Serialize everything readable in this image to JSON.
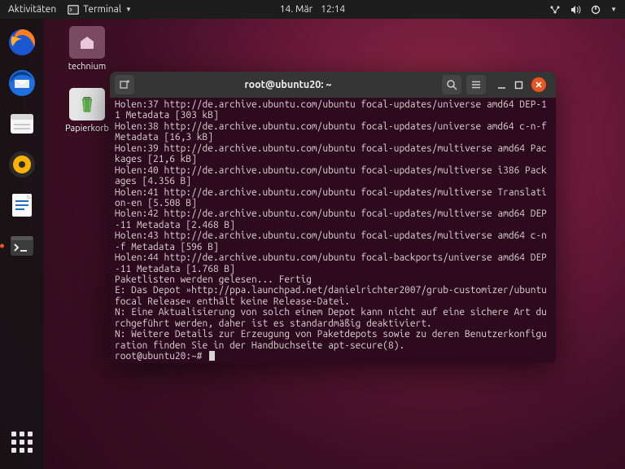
{
  "topbar": {
    "activities_label": "Aktivitäten",
    "app_name": "Terminal",
    "date": "14. Mär",
    "time": "12:14"
  },
  "desktop": {
    "home_label": "technium",
    "trash_label": "Papierkorb"
  },
  "dock": {
    "items": [
      {
        "name": "firefox"
      },
      {
        "name": "thunderbird"
      },
      {
        "name": "files"
      },
      {
        "name": "rhythmbox"
      },
      {
        "name": "libreoffice-writer"
      },
      {
        "name": "terminal",
        "active": true
      }
    ]
  },
  "terminal": {
    "title": "root@ubuntu20: ~",
    "lines": [
      "Holen:37 http://de.archive.ubuntu.com/ubuntu focal-updates/universe amd64 DEP-11 Metadata [303 kB]",
      "Holen:38 http://de.archive.ubuntu.com/ubuntu focal-updates/universe amd64 c-n-f Metadata [16,3 kB]",
      "Holen:39 http://de.archive.ubuntu.com/ubuntu focal-updates/multiverse amd64 Packages [21,6 kB]",
      "Holen:40 http://de.archive.ubuntu.com/ubuntu focal-updates/multiverse i386 Packages [4.356 B]",
      "Holen:41 http://de.archive.ubuntu.com/ubuntu focal-updates/multiverse Translation-en [5.508 B]",
      "Holen:42 http://de.archive.ubuntu.com/ubuntu focal-updates/multiverse amd64 DEP-11 Metadata [2.468 B]",
      "Holen:43 http://de.archive.ubuntu.com/ubuntu focal-updates/multiverse amd64 c-n-f Metadata [596 B]",
      "Holen:44 http://de.archive.ubuntu.com/ubuntu focal-backports/universe amd64 DEP-11 Metadata [1.768 B]",
      "Paketlisten werden gelesen... Fertig",
      "E: Das Depot »http://ppa.launchpad.net/danielrichter2007/grub-customizer/ubuntu focal Release« enthält keine Release-Datei.",
      "N: Eine Aktualisierung von solch einem Depot kann nicht auf eine sichere Art durchgeführt werden, daher ist es standardmäßig deaktiviert.",
      "N: Weitere Details zur Erzeugung von Paketdepots sowie zu deren Benutzerkonfiguration finden Sie in der Handbuchseite apt-secure(8)."
    ],
    "prompt": "root@ubuntu20:~# "
  }
}
